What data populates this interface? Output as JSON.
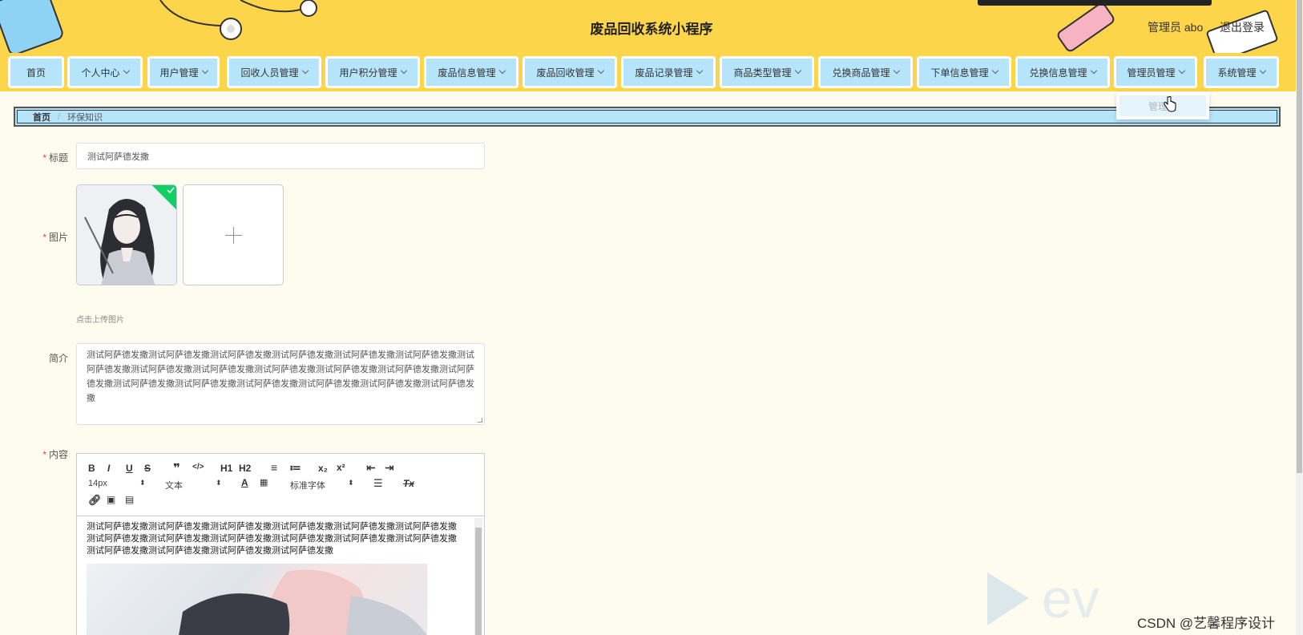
{
  "header": {
    "title": "废品回收系统小程序",
    "user_label": "管理员 abo",
    "logout_label": "退出登录"
  },
  "nav": {
    "items": [
      {
        "label": "首页",
        "has_dropdown": false
      },
      {
        "label": "个人中心",
        "has_dropdown": true
      },
      {
        "label": "用户管理",
        "has_dropdown": true
      },
      {
        "label": "回收人员管理",
        "has_dropdown": true
      },
      {
        "label": "用户积分管理",
        "has_dropdown": true
      },
      {
        "label": "废品信息管理",
        "has_dropdown": true
      },
      {
        "label": "废品回收管理",
        "has_dropdown": true
      },
      {
        "label": "废品记录管理",
        "has_dropdown": true
      },
      {
        "label": "商品类型管理",
        "has_dropdown": true
      },
      {
        "label": "兑换商品管理",
        "has_dropdown": true
      },
      {
        "label": "下单信息管理",
        "has_dropdown": true
      },
      {
        "label": "兑换信息管理",
        "has_dropdown": true
      },
      {
        "label": "管理员管理",
        "has_dropdown": true
      },
      {
        "label": "系统管理",
        "has_dropdown": true
      }
    ],
    "open_dropdown": {
      "parent": "管理员管理",
      "items": [
        "管理员"
      ]
    }
  },
  "breadcrumb": {
    "home": "首页",
    "separator": "/",
    "current": "环保知识"
  },
  "form": {
    "title": {
      "label": "标题",
      "required": true,
      "value": "测试阿萨德发撒"
    },
    "image": {
      "label": "图片",
      "required": true,
      "upload_tip": "点击上传图片"
    },
    "intro": {
      "label": "简介",
      "required": false,
      "value": "测试阿萨德发撒测试阿萨德发撒测试阿萨德发撒测试阿萨德发撒测试阿萨德发撒测试阿萨德发撒测试阿萨德发撒测试阿萨德发撒测试阿萨德发撒测试阿萨德发撒测试阿萨德发撒测试阿萨德发撒测试阿萨德发撒测试阿萨德发撒测试阿萨德发撒测试阿萨德发撒测试阿萨德发撒测试阿萨德发撒测试阿萨德发撒"
    },
    "content": {
      "label": "内容",
      "required": true,
      "toolbar": {
        "bold": "B",
        "italic": "I",
        "underline": "U",
        "strike": "S",
        "blockquote": "❞",
        "code": "</>",
        "h1": "H1",
        "h2": "H2",
        "ordered_list": "≡",
        "bullet_list": "≔",
        "subscript": "x₂",
        "superscript": "x²",
        "outdent": "⇤",
        "indent": "⇥",
        "size_value": "14px",
        "header_value": "文本",
        "font_value": "标准字体",
        "clear_format": "Tx"
      },
      "value": "测试阿萨德发撒测试阿萨德发撒测试阿萨德发撒测试阿萨德发撒测试阿萨德发撒测试阿萨德发撒测试阿萨德发撒测试阿萨德发撒测试阿萨德发撒测试阿萨德发撒测试阿萨德发撒测试阿萨德发撒测试阿萨德发撒测试阿萨德发撒测试阿萨德发撒测试阿萨德发撒"
    }
  },
  "watermark": {
    "csdn": "CSDN @艺馨程序设计"
  },
  "colors": {
    "header_bg": "#fcd54a",
    "nav_item_bg": "#b6e4fb",
    "page_bg": "#fefcef",
    "required": "#e14b4b",
    "success": "#13ce66"
  }
}
